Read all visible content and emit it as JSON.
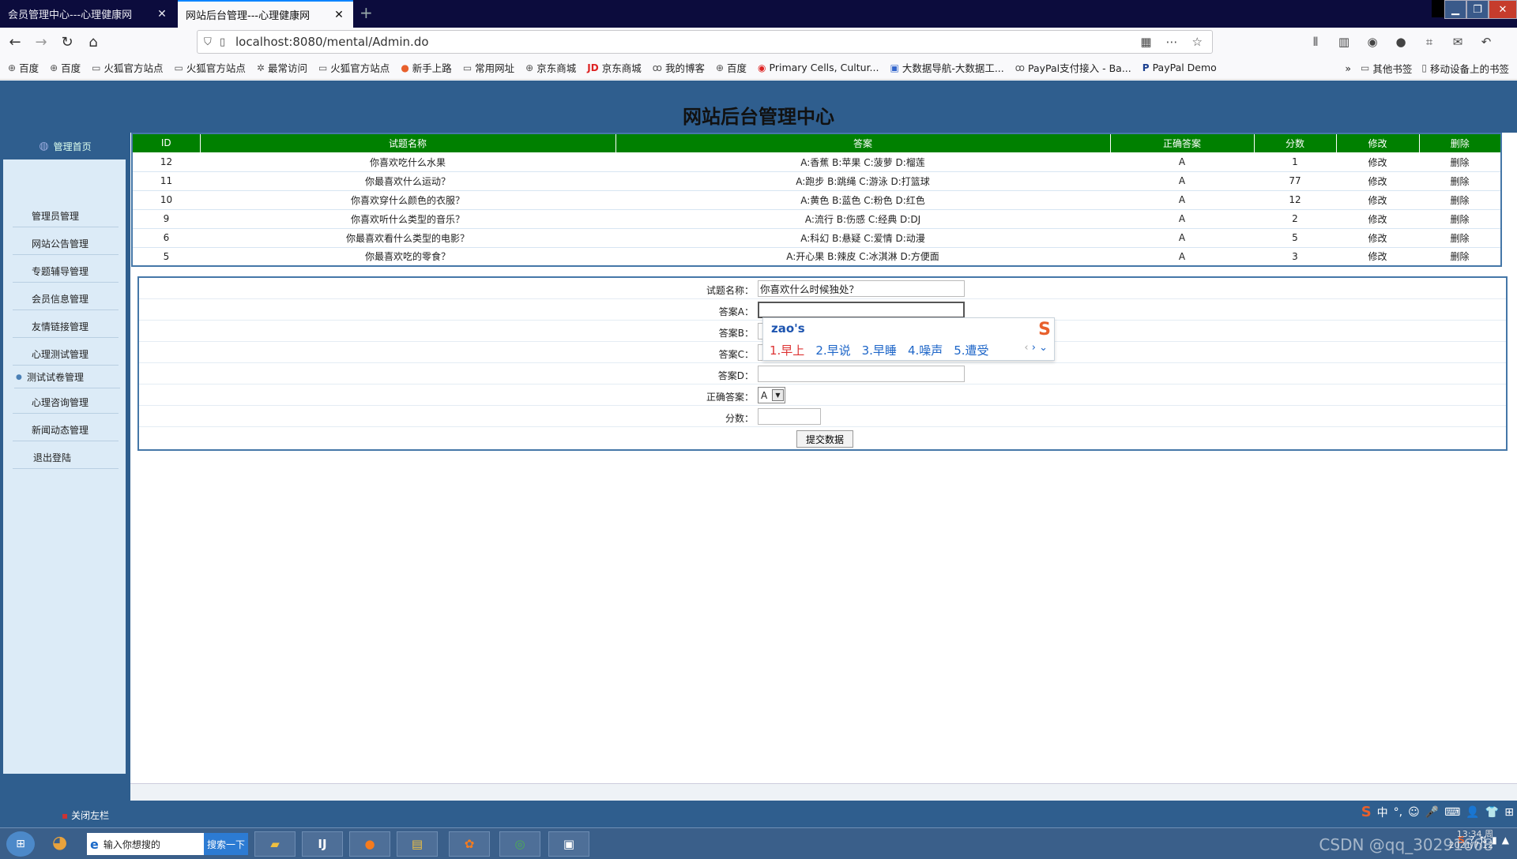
{
  "browser": {
    "tabs": [
      {
        "label": "会员管理中心---心理健康网",
        "close": "✕"
      },
      {
        "label": "网站后台管理---心理健康网",
        "close": "✕"
      }
    ],
    "new_tab": "+",
    "url": "localhost:8080/mental/Admin.do",
    "bookmarks": [
      {
        "icon": "globe-icon",
        "label": "百度"
      },
      {
        "icon": "globe-icon",
        "label": "百度"
      },
      {
        "icon": "folder-icon",
        "label": "火狐官方站点"
      },
      {
        "icon": "folder-icon",
        "label": "火狐官方站点"
      },
      {
        "icon": "gear-icon",
        "label": "最常访问"
      },
      {
        "icon": "folder-icon",
        "label": "火狐官方站点"
      },
      {
        "icon": "firefox-icon",
        "label": "新手上路"
      },
      {
        "icon": "folder-icon",
        "label": "常用网址"
      },
      {
        "icon": "globe-icon",
        "label": "京东商城"
      },
      {
        "icon": "jd-icon",
        "label": "京东商城"
      },
      {
        "icon": "blog-icon",
        "label": "我的博客"
      },
      {
        "icon": "globe-icon",
        "label": "百度"
      },
      {
        "icon": "page-icon",
        "label": "Primary Cells, Cultur..."
      },
      {
        "icon": "page-icon",
        "label": "大数据导航-大数据工..."
      },
      {
        "icon": "blog-icon",
        "label": "PayPal支付接入 - Ba..."
      },
      {
        "icon": "paypal-icon",
        "label": "PayPal Demo"
      }
    ],
    "bookmarks_right": [
      {
        "icon": "chevron-icon",
        "label": "»"
      },
      {
        "icon": "folder-icon",
        "label": "其他书签"
      },
      {
        "icon": "mobile-icon",
        "label": "移动设备上的书签"
      }
    ]
  },
  "page": {
    "title": "网站后台管理中心",
    "sidebar_head": "管理首页",
    "menu": [
      "管理员管理",
      "网站公告管理",
      "专题辅导管理",
      "会员信息管理",
      "友情链接管理",
      "心理测试管理",
      "测试试卷管理",
      "心理咨询管理",
      "新闻动态管理",
      "退出登陆"
    ],
    "active_menu_index": 6,
    "table": {
      "headers": [
        "ID",
        "试题名称",
        "答案",
        "正确答案",
        "分数",
        "修改",
        "删除"
      ],
      "rows": [
        [
          "12",
          "你喜欢吃什么水果",
          "A:香蕉 B:苹果 C:菠萝 D:榴莲",
          "A",
          "1",
          "修改",
          "删除"
        ],
        [
          "11",
          "你最喜欢什么运动？",
          "A:跑步 B:跳绳 C:游泳 D:打篮球",
          "A",
          "77",
          "修改",
          "删除"
        ],
        [
          "10",
          "你喜欢穿什么颜色的衣服？",
          "A:黄色 B:蓝色 C:粉色 D:红色",
          "A",
          "12",
          "修改",
          "删除"
        ],
        [
          "9",
          "你喜欢听什么类型的音乐？",
          "A:流行 B:伤感 C:经典 D:DJ",
          "A",
          "2",
          "修改",
          "删除"
        ],
        [
          "6",
          "你最喜欢看什么类型的电影？",
          "A:科幻 B:悬疑 C:爱情 D:动漫",
          "A",
          "5",
          "修改",
          "删除"
        ],
        [
          "5",
          "你最喜欢吃的零食？",
          "A:开心果 B:辣皮 C:冰淇淋 D:方便面",
          "A",
          "3",
          "修改",
          "删除"
        ]
      ]
    },
    "form": {
      "name_label": "试题名称：",
      "name_value": "你喜欢什么时候独处？",
      "a_label": "答案A：",
      "a_value": "",
      "b_label": "答案B：",
      "c_label": "答案C：",
      "d_label": "答案D：",
      "correct_label": "正确答案：",
      "correct_value": "A",
      "score_label": "分数：",
      "submit_label": "提交数据"
    },
    "close_left": "关闭左栏"
  },
  "ime": {
    "composition": "zao's",
    "candidates": [
      "1.早上",
      "2.早说",
      "3.早睡",
      "4.噪声",
      "5.遭受"
    ],
    "logo": "S",
    "bar": [
      "中",
      "°,",
      "☺",
      "🎤",
      "⌨",
      "👤",
      "👕",
      "⊞"
    ]
  },
  "taskbar": {
    "search_placeholder": "输入你想搜的",
    "search_button": "搜索一下",
    "watermark": "CSDN @qq_30291668",
    "clock_time": "13:34 周",
    "clock_date": "2021/7/12"
  },
  "colors": {
    "header_blue": "#2f5e8e",
    "table_header_green": "#008000",
    "sidebar_bg": "#dcebf7"
  }
}
